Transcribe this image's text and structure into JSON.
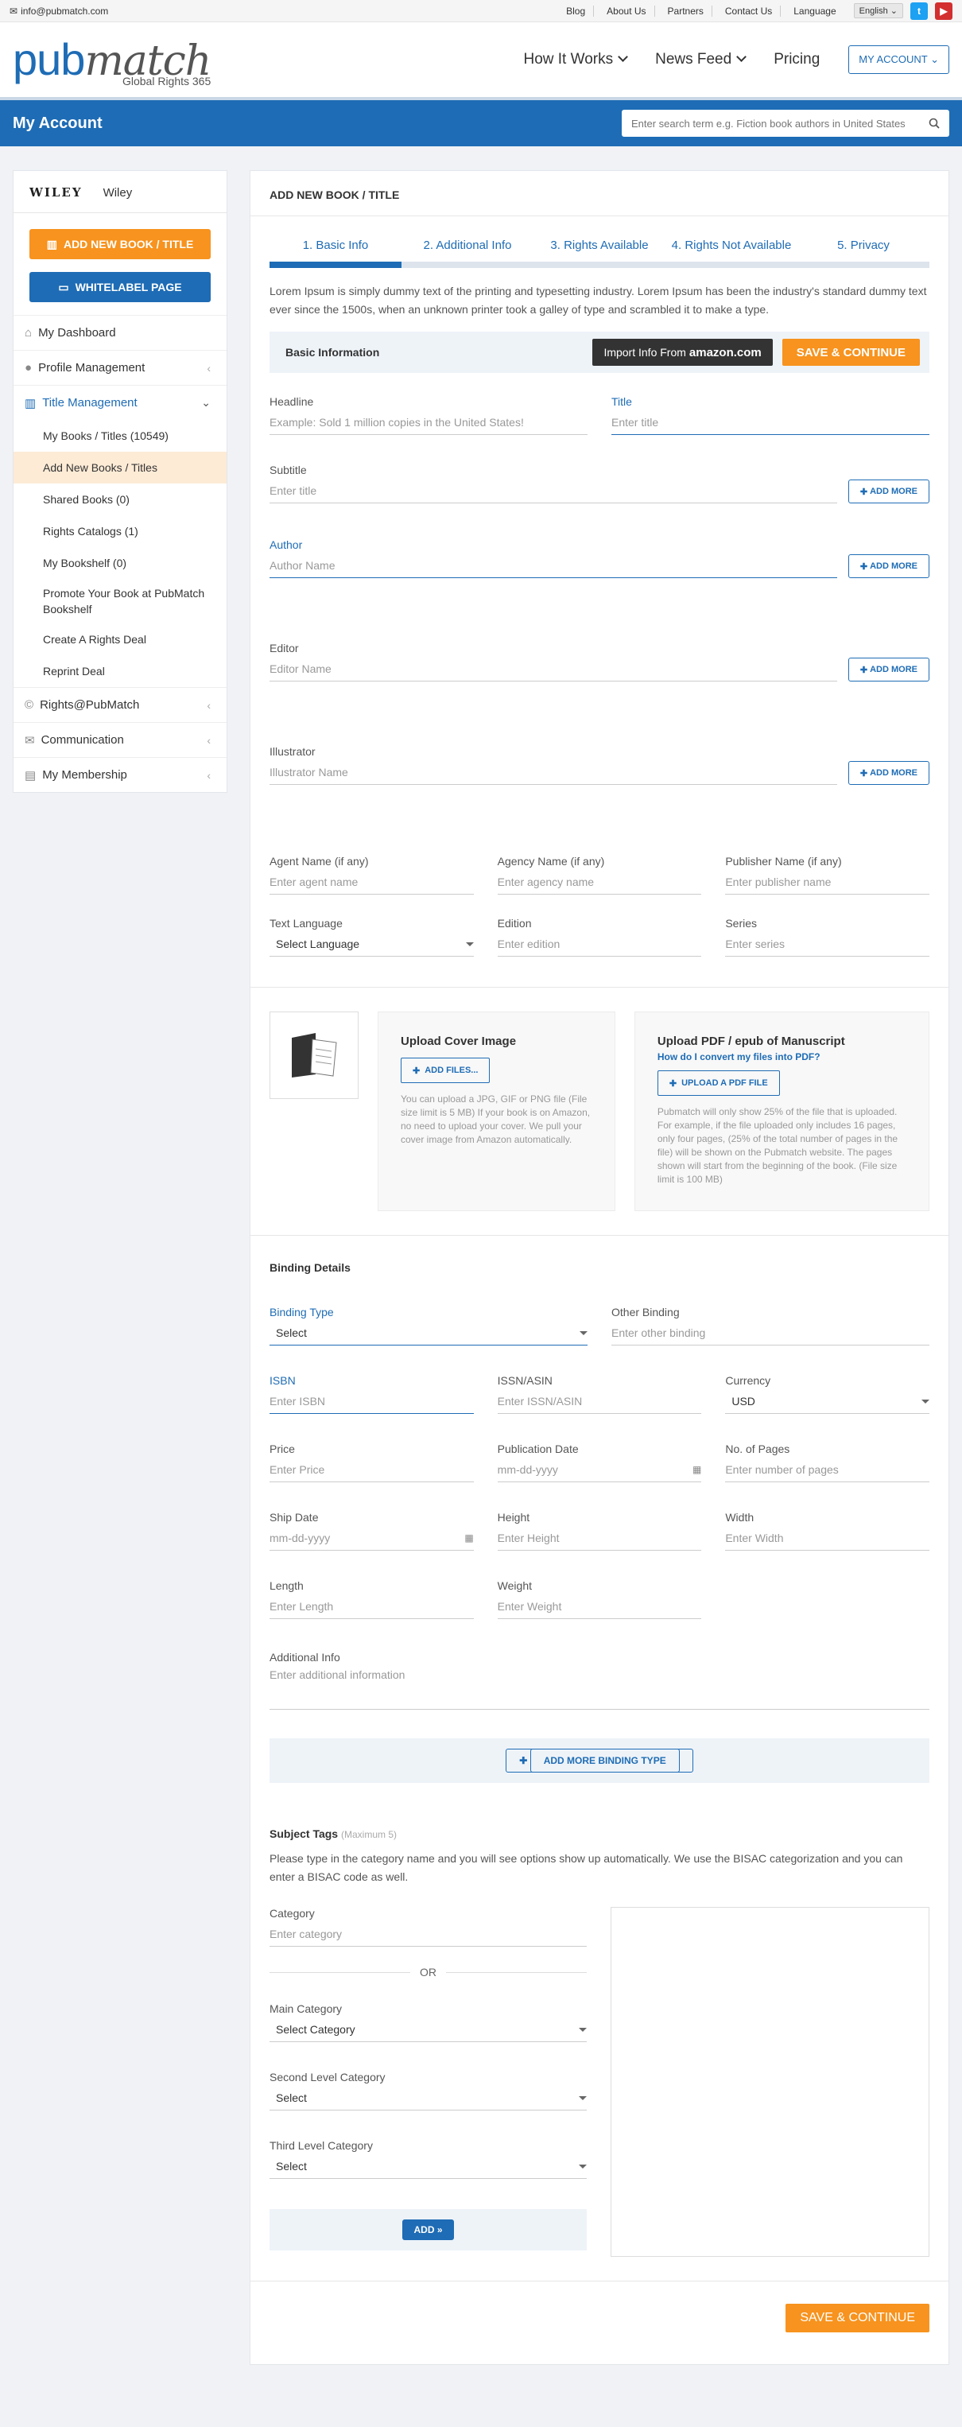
{
  "topbar": {
    "email": "info@pubmatch.com",
    "links": [
      "Blog",
      "About Us",
      "Partners",
      "Contact Us",
      "Language"
    ],
    "language": "English"
  },
  "header": {
    "logo_pub": "pub",
    "logo_match": "match",
    "logo_sub": "Global Rights 365",
    "nav": [
      "How It Works",
      "News Feed",
      "Pricing"
    ],
    "my_account": "MY ACCOUNT"
  },
  "bluebar": {
    "title": "My Account",
    "search_placeholder": "Enter search term e.g. Fiction book authors in United States"
  },
  "sidebar": {
    "brand_logo": "WILEY",
    "brand_name": "Wiley",
    "add_book": "ADD NEW BOOK / TITLE",
    "whitelabel": "WHITELABEL PAGE",
    "items": {
      "dashboard": "My Dashboard",
      "profile": "Profile Management",
      "title_mgmt": "Title Management",
      "rights": "Rights@PubMatch",
      "communication": "Communication",
      "membership": "My Membership"
    },
    "subs": [
      "My Books / Titles (10549)",
      "Add New Books / Titles",
      "Shared Books (0)",
      "Rights Catalogs (1)",
      "My Bookshelf (0)",
      "Promote Your Book at PubMatch Bookshelf",
      "Create A Rights Deal",
      "Reprint Deal"
    ]
  },
  "main": {
    "heading": "ADD NEW BOOK / TITLE",
    "steps": [
      "1. Basic Info",
      "2. Additional Info",
      "3. Rights Available",
      "4. Rights Not Available",
      "5. Privacy"
    ],
    "lorem": "Lorem Ipsum is simply dummy text of the printing and typesetting industry. Lorem Ipsum has been the industry's standard dummy text ever since the 1500s, when an unknown printer took a galley of type and scrambled it to make a type.",
    "basic_info": "Basic Information",
    "import_text": "Import Info From",
    "amazon": "amazon.com",
    "save_continue": "SAVE & CONTINUE",
    "add_more": "ADD MORE",
    "headline": {
      "label": "Headline",
      "placeholder": "Example: Sold 1 million copies in the United States!"
    },
    "title": {
      "label": "Title",
      "placeholder": "Enter title"
    },
    "subtitle": {
      "label": "Subtitle",
      "placeholder": "Enter title"
    },
    "author": {
      "label": "Author",
      "placeholder": "Author Name"
    },
    "editor": {
      "label": "Editor",
      "placeholder": "Editor Name"
    },
    "illustrator": {
      "label": "Illustrator",
      "placeholder": "Illustrator Name"
    },
    "agent": {
      "label": "Agent Name (if any)",
      "placeholder": "Enter agent name"
    },
    "agency": {
      "label": "Agency Name (if any)",
      "placeholder": "Enter agency name"
    },
    "publisher": {
      "label": "Publisher Name (if any)",
      "placeholder": "Enter publisher name"
    },
    "language": {
      "label": "Text Language",
      "value": "Select Language"
    },
    "edition": {
      "label": "Edition",
      "placeholder": "Enter edition"
    },
    "series": {
      "label": "Series",
      "placeholder": "Enter series"
    }
  },
  "upload": {
    "cover_title": "Upload Cover Image",
    "add_files": "ADD FILES...",
    "cover_note": "You can upload a JPG, GIF or PNG file (File size limit is 5 MB) If your book is on Amazon, no need to upload your cover. We pull your cover image from Amazon automatically.",
    "pdf_title": "Upload PDF / epub of Manuscript",
    "pdf_link": "How do I convert my files into PDF?",
    "pdf_btn": "UPLOAD A PDF FILE",
    "pdf_note": "Pubmatch will only show 25% of the file that is uploaded. For example, if the file uploaded only includes 16 pages, only four pages, (25% of the total number of pages in the file) will be shown on the Pubmatch website. The pages shown will start from the beginning of the book. (File size limit is 100 MB)"
  },
  "binding": {
    "heading": "Binding Details",
    "binding_type": {
      "label": "Binding Type",
      "value": "Select"
    },
    "other": {
      "label": "Other Binding",
      "placeholder": "Enter other binding"
    },
    "isbn": {
      "label": "ISBN",
      "placeholder": "Enter ISBN"
    },
    "issn": {
      "label": "ISSN/ASIN",
      "placeholder": "Enter ISSN/ASIN"
    },
    "currency": {
      "label": "Currency",
      "value": "USD"
    },
    "price": {
      "label": "Price",
      "placeholder": "Enter Price"
    },
    "pubdate": {
      "label": "Publication Date",
      "placeholder": "mm-dd-yyyy"
    },
    "pages": {
      "label": "No. of Pages",
      "placeholder": "Enter number of pages"
    },
    "ship": {
      "label": "Ship Date",
      "placeholder": "mm-dd-yyyy"
    },
    "height": {
      "label": "Height",
      "placeholder": "Enter Height"
    },
    "width": {
      "label": "Width",
      "placeholder": "Enter Width"
    },
    "length": {
      "label": "Length",
      "placeholder": "Enter Length"
    },
    "weight": {
      "label": "Weight",
      "placeholder": "Enter Weight"
    },
    "addinfo": {
      "label": "Additional Info",
      "placeholder": "Enter additional information"
    },
    "add_binding": "ADD MORE BINDING TYPE"
  },
  "tags": {
    "heading": "Subject Tags",
    "max": "(Maximum 5)",
    "desc": "Please type in the category name and you will see options show up automatically. We use the BISAC categorization and you can enter a BISAC code as well.",
    "category": {
      "label": "Category",
      "placeholder": "Enter category"
    },
    "or": "OR",
    "main_cat": {
      "label": "Main Category",
      "value": "Select Category"
    },
    "second": {
      "label": "Second Level Category",
      "value": "Select"
    },
    "third": {
      "label": "Third Level Category",
      "value": "Select"
    },
    "add": "ADD »"
  },
  "colors": {
    "brand": "#1e6cb5",
    "orange": "#f7931e"
  }
}
